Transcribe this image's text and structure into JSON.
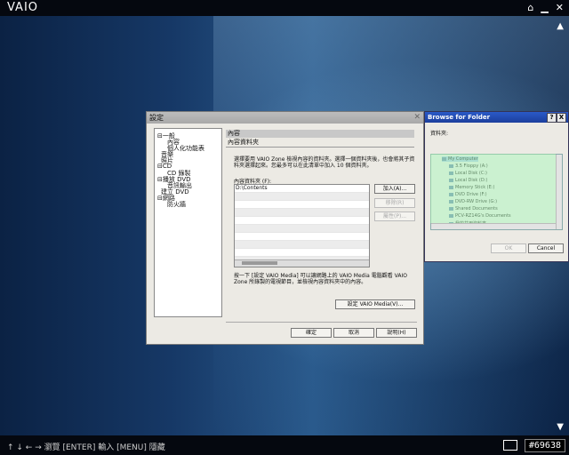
{
  "brand": {
    "logo": "VAIO",
    "tag": "#69638"
  },
  "bottombar": {
    "hints": "↑ ↓ ← →  瀏覽    [ENTER]  輸入    [MENU]  隱藏"
  },
  "settings": {
    "title": "設定",
    "tree": [
      {
        "label": "一般",
        "indent": 0,
        "expander": "⊟"
      },
      {
        "label": "內容",
        "indent": 1,
        "expander": ""
      },
      {
        "label": "個人化功能表",
        "indent": 1,
        "expander": ""
      },
      {
        "label": "音樂",
        "indent": 0,
        "expander": ""
      },
      {
        "label": "照片",
        "indent": 0,
        "expander": ""
      },
      {
        "label": "CD",
        "indent": 0,
        "expander": "⊟"
      },
      {
        "label": "CD 錄製",
        "indent": 1,
        "expander": ""
      },
      {
        "label": "播放 DVD",
        "indent": 0,
        "expander": "⊟"
      },
      {
        "label": "音訊輸出",
        "indent": 1,
        "expander": ""
      },
      {
        "label": "建立 DVD",
        "indent": 0,
        "expander": ""
      },
      {
        "label": "網路",
        "indent": 0,
        "expander": "⊟"
      },
      {
        "label": "防火牆",
        "indent": 1,
        "expander": ""
      }
    ],
    "section_header": "內容",
    "section_sub": "內容資料夾",
    "description": "選擇要用 VAIO Zone 檢視內容的資料夾。選擇一個資料夾後，也會將其子資料夾選擇起來。您最多可以在此清單中加入 10 個資料夾。",
    "list_label": "內容資料夾 (F):",
    "folders": [
      "D:\\Contents"
    ],
    "add_button": "加入(A)...",
    "remove_button": "移除(R)",
    "properties_button": "屬性(P)...",
    "note": "按一下 [設定 VAIO Media] 可以讓網路上的 VAIO Media 電腦觀看 VAIO Zone 所錄製的電視節目，並檢視內容資料夾中的內容。",
    "vaio_media_button": "設定 VAIO Media(V)...",
    "ok_button": "確定",
    "cancel_button": "取消",
    "help_button": "說明(H)"
  },
  "browse": {
    "title": "Browse for Folder",
    "help": "?",
    "close": "X",
    "label": "資料夾:",
    "items": [
      {
        "label": "My Computer",
        "indent": 0,
        "selected": true
      },
      {
        "label": "3.5 Floppy (A:)",
        "indent": 1,
        "selected": false
      },
      {
        "label": "Local Disk (C:)",
        "indent": 1,
        "selected": false
      },
      {
        "label": "Local Disk (D:)",
        "indent": 1,
        "selected": false
      },
      {
        "label": "Memory Stick (E:)",
        "indent": 1,
        "selected": false
      },
      {
        "label": "DVD Drive (F:)",
        "indent": 1,
        "selected": false
      },
      {
        "label": "DVD-RW Drive (G:)",
        "indent": 1,
        "selected": false
      },
      {
        "label": "Shared Documents",
        "indent": 1,
        "selected": false
      },
      {
        "label": "PCV-RZ14G's Documents",
        "indent": 1,
        "selected": false
      },
      {
        "label": "我的共用資料夾",
        "indent": 1,
        "selected": false
      }
    ],
    "ok_button": "OK",
    "cancel_button": "Cancel"
  }
}
